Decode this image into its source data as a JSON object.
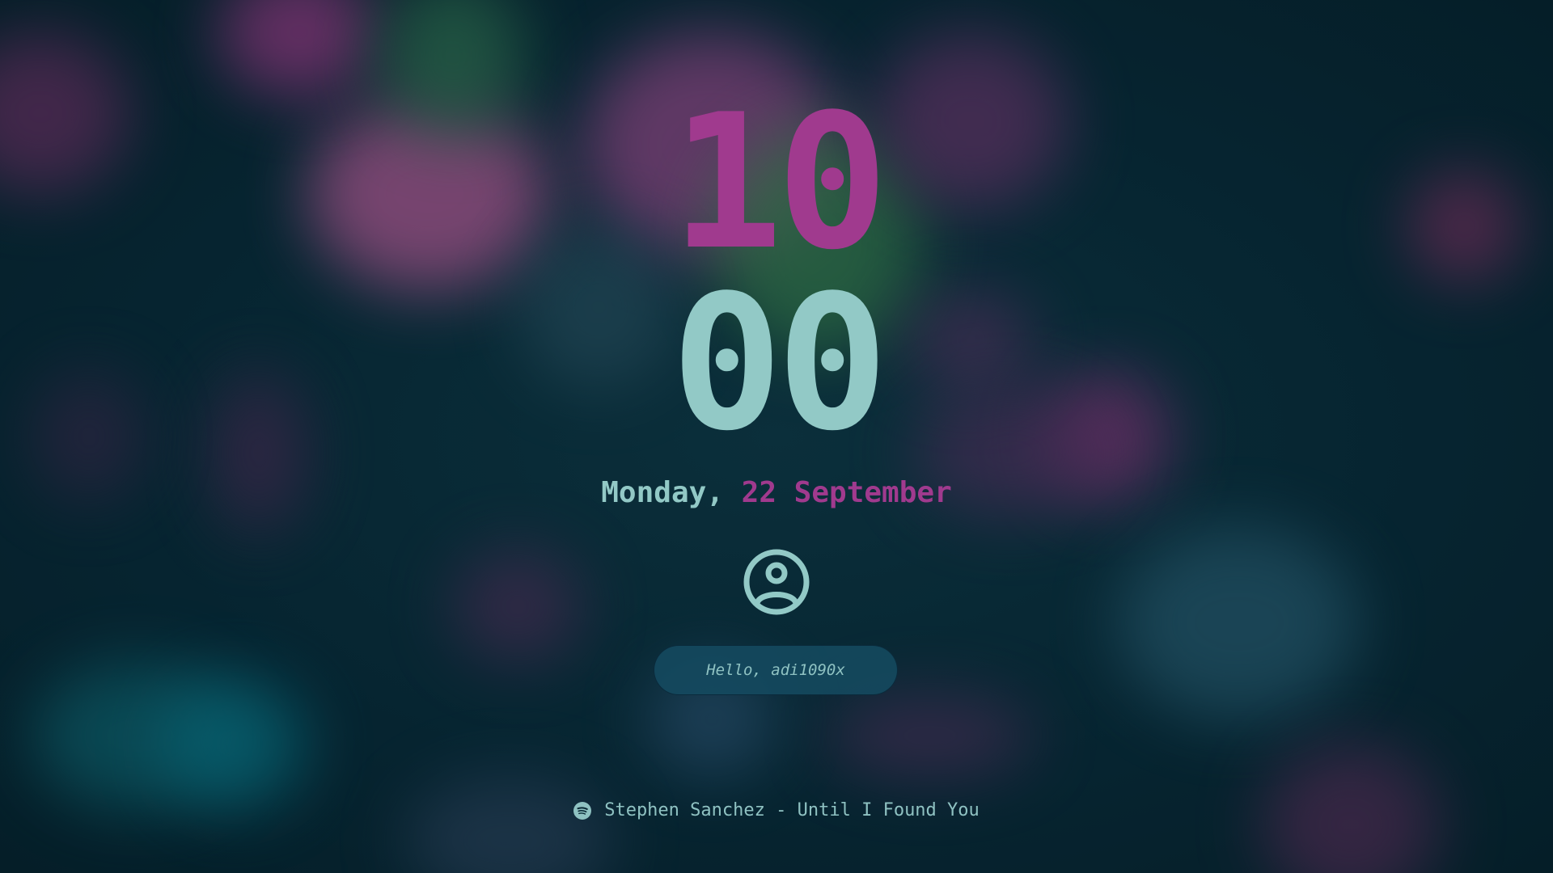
{
  "clock": {
    "hour": "10",
    "minute": "00"
  },
  "date": {
    "weekday": "Monday,",
    "day_month": "22 September"
  },
  "avatar": {
    "icon": "user-circle-icon"
  },
  "greeting": {
    "text": "Hello, adi1090x"
  },
  "media": {
    "icon": "spotify-icon",
    "track": "Stephen Sanchez - Until I Found You"
  },
  "colors": {
    "accent_magenta": "#a03a8e",
    "accent_teal": "#92c9c6",
    "background": "#06232e",
    "input_bg": "#144a60"
  }
}
